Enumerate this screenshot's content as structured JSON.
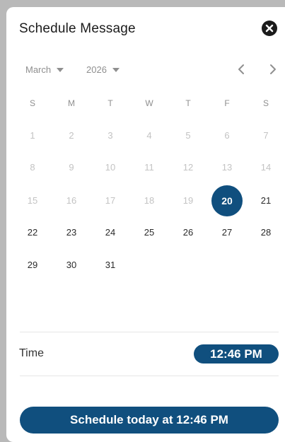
{
  "dialog": {
    "title": "Schedule Message",
    "close_icon": "close-icon"
  },
  "calendar": {
    "month": "March",
    "year": "2026",
    "prev_icon": "chevron-left-icon",
    "next_icon": "chevron-right-icon",
    "weekdays": [
      "S",
      "M",
      "T",
      "W",
      "T",
      "F",
      "S"
    ],
    "weeks": [
      [
        "1",
        "2",
        "3",
        "4",
        "5",
        "6",
        "7"
      ],
      [
        "8",
        "9",
        "10",
        "11",
        "12",
        "13",
        "14"
      ],
      [
        "15",
        "16",
        "17",
        "18",
        "19",
        "20",
        "21"
      ],
      [
        "22",
        "23",
        "24",
        "25",
        "26",
        "27",
        "28"
      ],
      [
        "29",
        "30",
        "31",
        "",
        "",
        "",
        ""
      ]
    ],
    "selected_day": "20",
    "first_enabled_day": 20
  },
  "time": {
    "label": "Time",
    "value": "12:46 PM"
  },
  "action": {
    "schedule_label": "Schedule today at 12:46 PM"
  },
  "colors": {
    "accent": "#104f7e",
    "text": "#1b1b1b",
    "muted": "#8f8f8f",
    "disabled": "#c3c3c3"
  }
}
